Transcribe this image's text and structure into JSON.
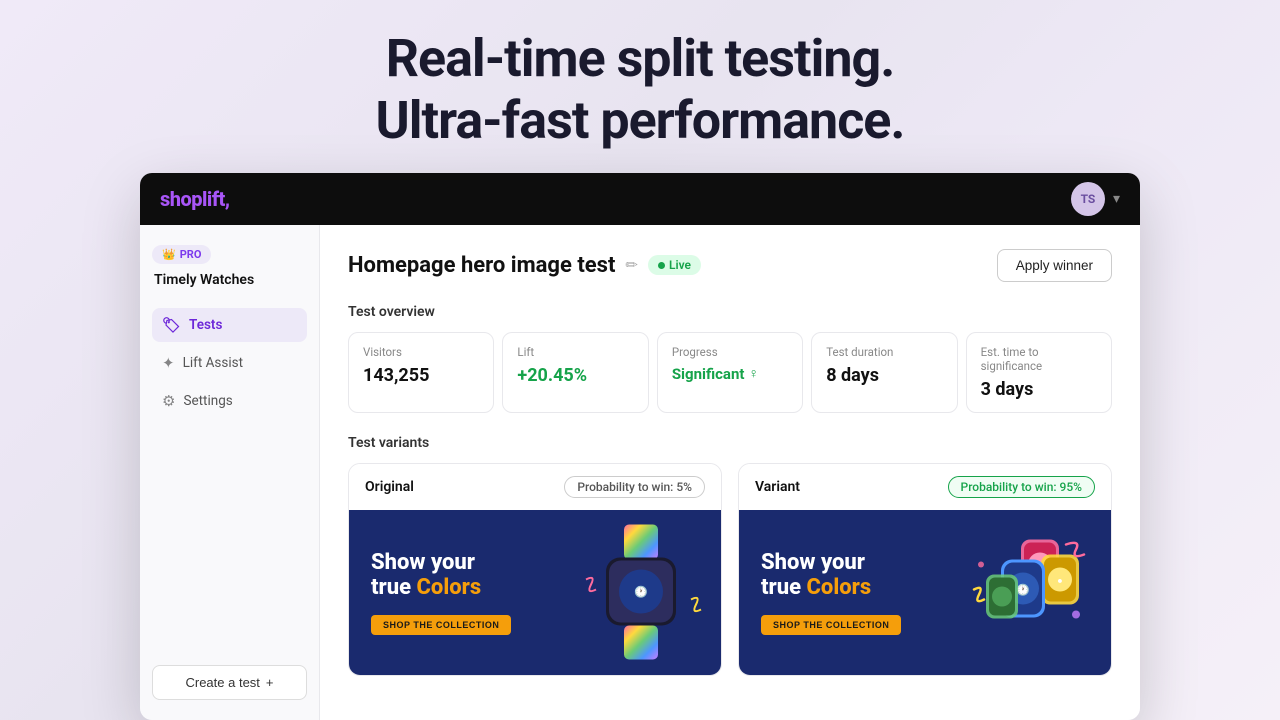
{
  "hero": {
    "line1": "Real-time split testing.",
    "line2": "Ultra-fast performance."
  },
  "topnav": {
    "logo": "shoplift",
    "logo_dot": ".",
    "user_initials": "TS"
  },
  "sidebar": {
    "pro_badge": "PRO",
    "store_name": "Timely Watches",
    "items": [
      {
        "id": "tests",
        "label": "Tests",
        "icon": "🏷",
        "active": true
      },
      {
        "id": "lift-assist",
        "label": "Lift Assist",
        "icon": "⚙",
        "active": false
      },
      {
        "id": "settings",
        "label": "Settings",
        "icon": "⚙",
        "active": false
      }
    ],
    "create_test_label": "Create a test",
    "create_icon": "+"
  },
  "content": {
    "page_title": "Homepage hero image test",
    "live_label": "Live",
    "apply_winner_label": "Apply winner",
    "test_overview_title": "Test overview",
    "overview_cards": [
      {
        "label": "Visitors",
        "value": "143,255",
        "type": "normal"
      },
      {
        "label": "Lift",
        "value": "+20.45%",
        "type": "positive"
      },
      {
        "label": "Progress",
        "value": "Significant",
        "type": "significant"
      },
      {
        "label": "Test duration",
        "value": "8 days",
        "type": "normal"
      },
      {
        "label": "Est. time to significance",
        "value": "3 days",
        "type": "normal"
      }
    ],
    "test_variants_title": "Test variants",
    "variants": [
      {
        "id": "original",
        "name": "Original",
        "prob_label": "Probability to win: 5%",
        "prob_type": "normal",
        "ad_headline_line1": "Show your",
        "ad_headline_line2": "true",
        "ad_headline_colored": "Colors",
        "shop_btn_label": "SHOP THE COLLECTION"
      },
      {
        "id": "variant",
        "name": "Variant",
        "prob_label": "Probability to win: 95%",
        "prob_type": "winner",
        "ad_headline_line1": "Show your",
        "ad_headline_line2": "true",
        "ad_headline_colored": "Colors",
        "shop_btn_label": "SHOP THE COLLECTION"
      }
    ]
  }
}
